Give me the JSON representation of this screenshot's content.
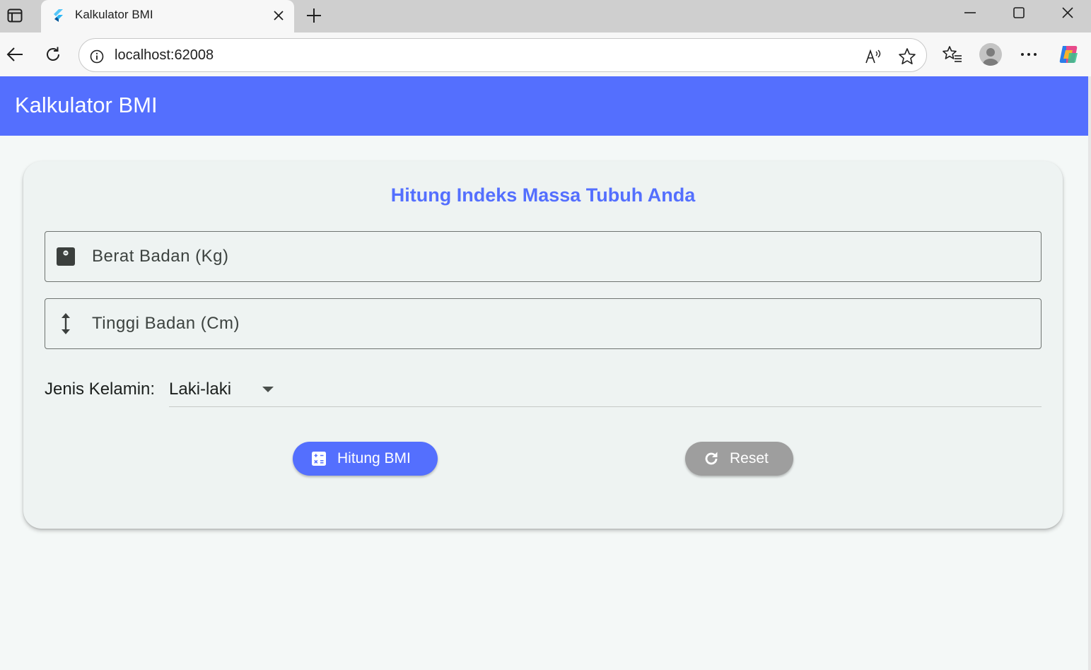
{
  "browser": {
    "tab_title": "Kalkulator BMI",
    "url": "localhost:62008",
    "icons": {
      "tab_actions": "tab-actions-icon",
      "favicon": "flutter-logo-icon",
      "tab_close": "close-icon",
      "new_tab": "plus-icon",
      "minimize": "minimize-icon",
      "maximize": "maximize-icon",
      "close": "close-icon",
      "back": "back-arrow-icon",
      "refresh": "refresh-icon",
      "site_info": "info-icon",
      "read_aloud": "read-aloud-icon",
      "favorite": "star-icon",
      "favorites": "favorites-list-icon",
      "profile": "profile-avatar",
      "more": "more-icon",
      "copilot": "copilot-icon"
    }
  },
  "app": {
    "title": "Kalkulator BMI",
    "accent_color": "#546ffe",
    "card": {
      "heading": "Hitung Indeks Massa Tubuh Anda",
      "weight_field": {
        "label": "Berat Badan (Kg)",
        "value": "",
        "icon": "scale-icon"
      },
      "height_field": {
        "label": "Tinggi Badan (Cm)",
        "value": "",
        "icon": "height-arrows-icon"
      },
      "gender": {
        "label": "Jenis Kelamin:",
        "selected": "Laki-laki"
      },
      "buttons": {
        "calculate": {
          "label": "Hitung BMI",
          "icon": "calculator-icon",
          "color": "#546ffe"
        },
        "reset": {
          "label": "Reset",
          "icon": "refresh-icon",
          "color": "#9e9e9e"
        }
      }
    }
  }
}
